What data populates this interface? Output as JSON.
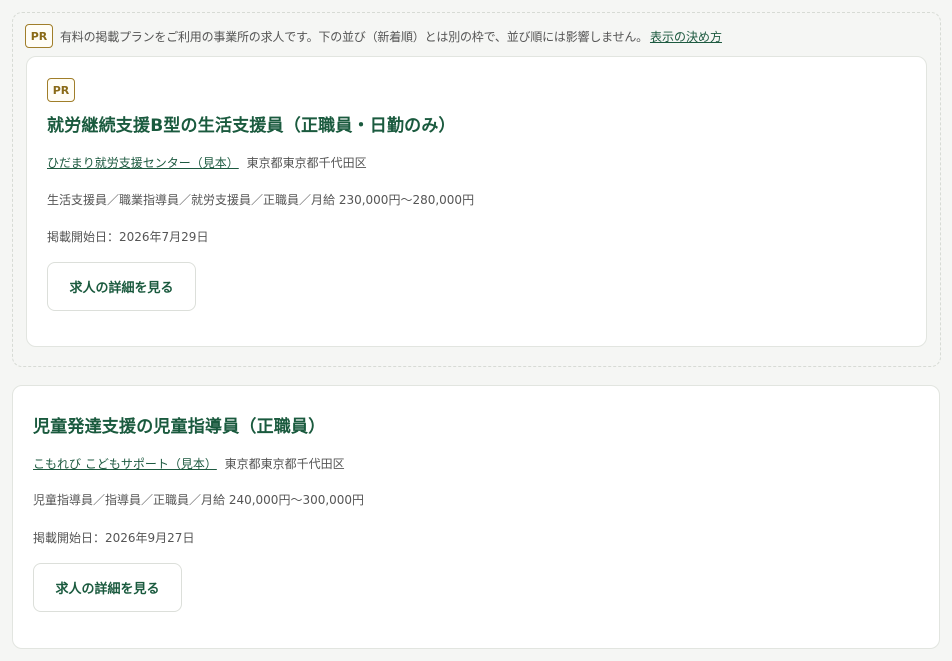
{
  "pr_section": {
    "badge": "PR",
    "note": "有料の掲載プランをご利用の事業所の求人です。下の並び（新着順）とは別の枠で、並び順には影響しません。",
    "note_link": "表示の決め方"
  },
  "jobs": [
    {
      "badge": "PR",
      "title": "就労継続支援B型の生活支援員（正職員・日勤のみ）",
      "employer": "ひだまり就労支援センター（見本）",
      "location": "東京都東京都千代田区",
      "tags": "生活支援員／職業指導員／就労支援員／正職員／月給 230,000円〜280,000円",
      "posted": "掲載開始日：2026年7月29日",
      "button": "求人の詳細を見る"
    },
    {
      "title": "児童発達支援の児童指導員（正職員）",
      "employer": "こもれび こどもサポート（見本）",
      "location": "東京都東京都千代田区",
      "tags": "児童指導員／指導員／正職員／月給 240,000円〜300,000円",
      "posted": "掲載開始日：2026年9月27日",
      "button": "求人の詳細を見る"
    }
  ]
}
